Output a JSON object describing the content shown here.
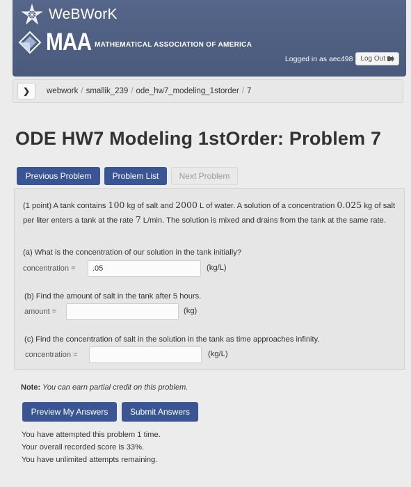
{
  "header": {
    "brand": "WeBWorK",
    "maa_logo": "MAA",
    "maa_name": "MATHEMATICAL ASSOCIATION OF AMERICA",
    "logged_in_text": "Logged in as aec498",
    "logout_label": "Log Out",
    "colors": {
      "background": "#4c5c7d",
      "text": "#ffffff"
    }
  },
  "breadcrumb": {
    "toggle_icon": "chevron-right-icon",
    "items": [
      "webwork",
      "smallik_239",
      "ode_hw7_modeling_1storder",
      "7"
    ]
  },
  "page_title": "ODE HW7 Modeling 1stOrder: Problem 7",
  "nav": {
    "previous_label": "Previous Problem",
    "list_label": "Problem List",
    "next_label": "Next Problem",
    "primary_color": "#3a5594"
  },
  "problem": {
    "intro_prefix": "(1 point) A tank contains ",
    "salt_kg": "100",
    "intro_mid1": " kg of salt and ",
    "water_l": "2000",
    "intro_mid2": " L of water. A solution of a concentration ",
    "conc_value": "0.025",
    "intro_mid3": " kg of salt per liter enters a tank at the rate ",
    "rate_value": "7",
    "intro_suffix": " L/min. The solution is mixed and drains from the tank at the same rate.",
    "parts": [
      {
        "question": "(a) What is the concentration of our solution in the tank initially?",
        "label": "concentration =",
        "value": ".05",
        "unit": "(kg/L)"
      },
      {
        "question": "(b) Find the amount of salt in the tank after 5 hours.",
        "label": "amount =",
        "value": "",
        "unit": "(kg)"
      },
      {
        "question": "(c) Find the concentration of salt in the solution in the tank as time approaches infinity.",
        "label": "concentration =",
        "value": "",
        "unit": "(kg/L)"
      }
    ]
  },
  "note": {
    "label": "Note:",
    "text": "You can earn partial credit on this problem."
  },
  "actions": {
    "preview_label": "Preview My Answers",
    "submit_label": "Submit Answers"
  },
  "status": {
    "attempts": "You have attempted this problem 1 time.",
    "score": "Your overall recorded score is 33%.",
    "remaining": "You have unlimited attempts remaining."
  }
}
